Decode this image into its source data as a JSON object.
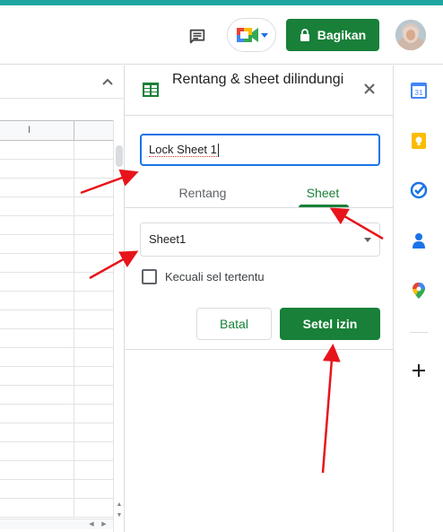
{
  "header": {
    "share_label": "Bagikan",
    "icons": [
      "comment-icon",
      "meet-icon",
      "lock-icon",
      "avatar"
    ]
  },
  "grid": {
    "column_label": "I"
  },
  "panel": {
    "title": "Rentang & sheet dilindungi",
    "name_value": "Lock Sheet 1",
    "tabs": [
      {
        "label": "Rentang",
        "active": false
      },
      {
        "label": "Sheet",
        "active": true
      }
    ],
    "sheet_selected": "Sheet1",
    "except_label": "Kecuali sel tertentu",
    "cancel_label": "Batal",
    "set_label": "Setel izin"
  },
  "rail": {
    "items": [
      "calendar-icon",
      "keep-icon",
      "tasks-icon",
      "contacts-icon",
      "maps-icon",
      "add-icon"
    ],
    "calendar_day": "31"
  },
  "colors": {
    "brand_green": "#188038",
    "focus_blue": "#1a73e8",
    "arrow_red": "#e8141b",
    "top_strip": "#1fa5a0"
  }
}
